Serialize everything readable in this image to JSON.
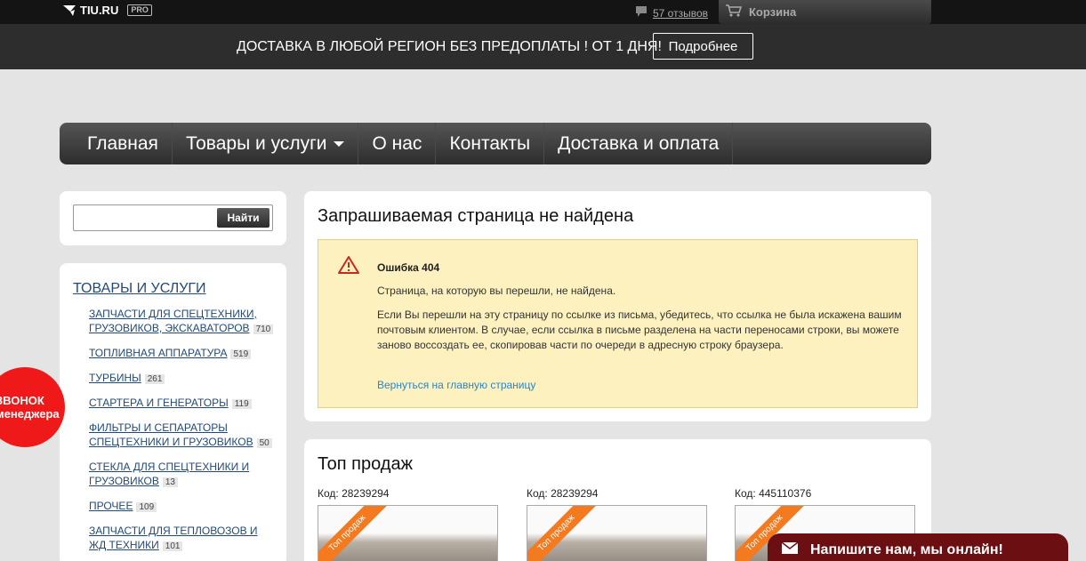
{
  "topbar": {
    "logo_text": "TIU.RU",
    "pro_badge": "PRO",
    "reviews_link": "57 отзывов",
    "cart_label": "Корзина"
  },
  "promo": {
    "text": "ДОСТАВКА В ЛЮБОЙ РЕГИОН БЕЗ ПРЕДОПЛАТЫ ! ОТ 1 ДНЯ!",
    "button": "Подробнее"
  },
  "nav": {
    "items": [
      "Главная",
      "Товары и услуги",
      "О нас",
      "Контакты",
      "Доставка и оплата"
    ]
  },
  "search": {
    "value": "",
    "button": "Найти"
  },
  "categories": {
    "title": "ТОВАРЫ И УСЛУГИ",
    "items": [
      {
        "label": "ЗАПЧАСТИ ДЛЯ СПЕЦТЕХНИКИ, ГРУЗОВИКОВ, ЭКСКАВАТОРОВ",
        "count": "710"
      },
      {
        "label": "ТОПЛИВНАЯ АППАРАТУРА",
        "count": "519"
      },
      {
        "label": "ТУРБИНЫ",
        "count": "261"
      },
      {
        "label": "СТАРТЕРА И ГЕНЕРАТОРЫ",
        "count": "119"
      },
      {
        "label": "ФИЛЬТРЫ И СЕПАРАТОРЫ СПЕЦТЕХНИКИ И ГРУЗОВИКОВ",
        "count": "50"
      },
      {
        "label": "СТЕКЛА ДЛЯ СПЕЦТЕХНИКИ И ГРУЗОВИКОВ",
        "count": "13"
      },
      {
        "label": "ПРОЧЕЕ",
        "count": "109"
      },
      {
        "label": "ЗАПЧАСТИ ДЛЯ ТЕПЛОВОЗОВ И ЖД ТЕХНИКИ",
        "count": "101"
      }
    ]
  },
  "callback": {
    "line1": "ЗВОНОК",
    "line2": "менеджера"
  },
  "error": {
    "title": "Запрашиваемая страница не найдена",
    "code": "Ошибка 404",
    "message": "Страница, на которую вы перешли, не найдена.",
    "details": "Если Вы перешли на эту страницу по ссылке из письма, убедитесь, что ссылка не была искажена вашим почтовым клиентом. В случае, если ссылка в письме разделена на части переносами строки, вы можете заново воссоздать ее, скопировав части по очереди в адресную строку браузера.",
    "home_link": "Вернуться на главную страницу"
  },
  "top_sales": {
    "title": "Топ продаж",
    "products": [
      {
        "code": "Код: 28239294",
        "badge": "Топ продаж"
      },
      {
        "code": "Код: 28239294",
        "badge": "Топ продаж"
      },
      {
        "code": "Код: 445110376",
        "badge": "Топ продаж"
      }
    ]
  },
  "chat": {
    "label": "Напишите нам, мы онлайн!"
  },
  "colors": {
    "accent_red": "#f01919",
    "link_blue": "#1f4a7a",
    "alert_bg": "#fdf1c0",
    "ribbon_orange": "#f47a1f",
    "chat_bg": "#6b0f12"
  }
}
